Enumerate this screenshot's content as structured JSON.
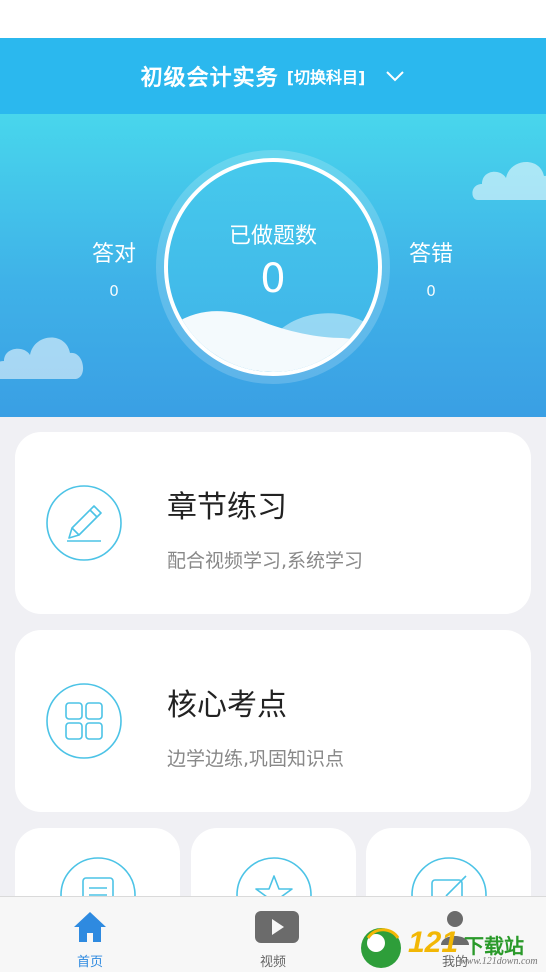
{
  "header": {
    "subject": "初级会计实务",
    "switch_label": "[切换科目]"
  },
  "stats": {
    "correct_label": "答对",
    "correct_value": "0",
    "done_label": "已做题数",
    "done_value": "0",
    "wrong_label": "答错",
    "wrong_value": "0"
  },
  "cards": [
    {
      "title": "章节练习",
      "subtitle": "配合视频学习,系统学习",
      "icon": "pencil-icon"
    },
    {
      "title": "核心考点",
      "subtitle": "边学边练,巩固知识点",
      "icon": "grid-icon"
    }
  ],
  "small_cards": [
    {
      "icon": "document-icon"
    },
    {
      "icon": "star-icon"
    },
    {
      "icon": "edit-icon"
    }
  ],
  "tabs": [
    {
      "label": "首页",
      "icon": "home-icon",
      "active": true
    },
    {
      "label": "视频",
      "icon": "video-play-icon",
      "active": false
    },
    {
      "label": "我的",
      "icon": "person-icon",
      "active": false
    }
  ],
  "watermark": {
    "number": "121",
    "text": "下载站",
    "url": "www.121down.com"
  },
  "colors": {
    "header_bg": "#2bb8ee",
    "hero_top": "#48d6ec",
    "hero_bottom": "#3a9fe4",
    "accent_icon": "#4cc3e6",
    "tab_active": "#2e8ae0"
  }
}
